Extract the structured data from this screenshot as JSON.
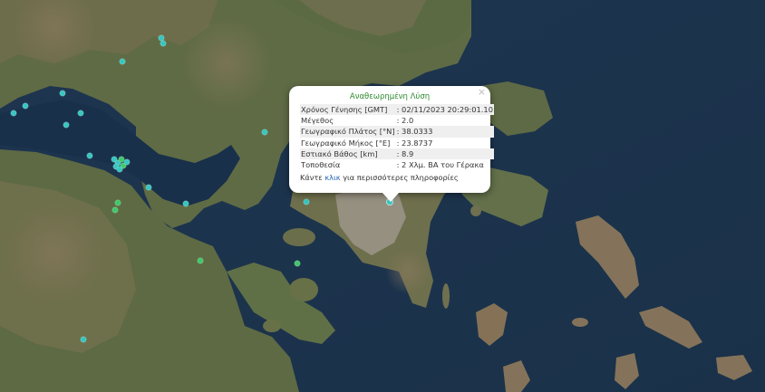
{
  "popup": {
    "title": "Αναθεωρημένη Λύση",
    "rows": [
      {
        "label": "Χρόνος Γένησης [GMT]",
        "value": ": 02/11/2023 20:29:01.10"
      },
      {
        "label": "Μέγεθος",
        "value": ": 2.0"
      },
      {
        "label": "Γεωγραφικό Πλάτος [°N]",
        "value": ": 38.0333"
      },
      {
        "label": "Γεωγραφικό Μήκος [°E]",
        "value": ": 23.8737"
      },
      {
        "label": "Εστιακό Βάθος [km]",
        "value": ": 8.9"
      },
      {
        "label": "Τοποθεσία",
        "value": ": 2 Χλμ. ΒΑ του Γέρακα"
      }
    ],
    "more_prefix": "Κάντε ",
    "more_link": "κλικ",
    "more_suffix": " για περισσότερες πληροφορίες",
    "close_symbol": "×"
  },
  "colors": {
    "sea": "#1d3450",
    "land": "#6a6a4e",
    "marker_cyan": "#37c6c0",
    "marker_green": "#3ec86a"
  }
}
